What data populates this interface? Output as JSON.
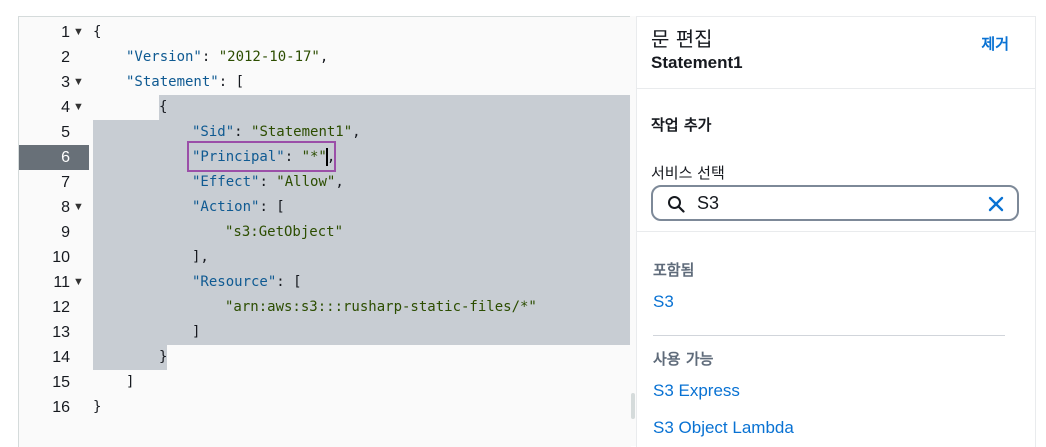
{
  "editor": {
    "active_line": 6,
    "lines": [
      {
        "num": "1",
        "fold": true
      },
      {
        "num": "2",
        "fold": false
      },
      {
        "num": "3",
        "fold": true
      },
      {
        "num": "4",
        "fold": true
      },
      {
        "num": "5",
        "fold": false
      },
      {
        "num": "6",
        "fold": false
      },
      {
        "num": "7",
        "fold": false
      },
      {
        "num": "8",
        "fold": true
      },
      {
        "num": "9",
        "fold": false
      },
      {
        "num": "10",
        "fold": false
      },
      {
        "num": "11",
        "fold": true
      },
      {
        "num": "12",
        "fold": false
      },
      {
        "num": "13",
        "fold": false
      },
      {
        "num": "14",
        "fold": false
      },
      {
        "num": "15",
        "fold": false
      },
      {
        "num": "16",
        "fold": false
      }
    ],
    "code": {
      "l1": "{",
      "l2_key": "\"Version\"",
      "l2_val": "\"2012-10-17\"",
      "l3_key": "\"Statement\"",
      "l3_rest": ": [",
      "l4": "{",
      "l5_key": "\"Sid\"",
      "l5_val": "\"Statement1\"",
      "l6_key": "\"Principal\"",
      "l6_val": "\"*\"",
      "l7_key": "\"Effect\"",
      "l7_val": "\"Allow\"",
      "l8_key": "\"Action\"",
      "l8_rest": ": [",
      "l9_val": "\"s3:GetObject\"",
      "l10": "],",
      "l11_key": "\"Resource\"",
      "l11_rest": ": [",
      "l12_val": "\"arn:aws:s3:::rusharp-static-files/*\"",
      "l13": "]",
      "l14": "}",
      "l15": "]",
      "l16": "}",
      "colon_sep": ": ",
      "comma": ","
    }
  },
  "panel": {
    "title": "문 편집",
    "subtitle": "Statement1",
    "remove_label": "제거",
    "add_action_title": "작업 추가",
    "service_select_label": "서비스 선택",
    "search": {
      "value": "S3"
    },
    "included": {
      "title": "포함됨",
      "items": [
        "S3"
      ]
    },
    "available": {
      "title": "사용 가능",
      "items": [
        "S3 Express",
        "S3 Object Lambda"
      ]
    }
  },
  "colors": {
    "link": "#0972d3",
    "highlight_border": "#9b4fa8",
    "selection": "#c8cdd3",
    "active_gutter": "#687078"
  }
}
